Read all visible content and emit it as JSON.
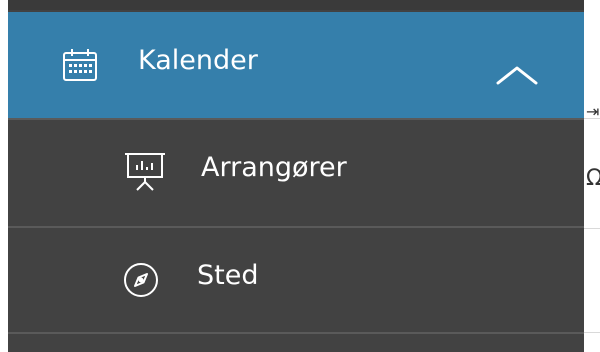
{
  "menu": {
    "items": [
      {
        "label": "Kalender",
        "icon": "calendar-icon",
        "expanded": true
      },
      {
        "label": "Arrangører",
        "icon": "presentation-chart-icon"
      },
      {
        "label": "Sted",
        "icon": "compass-icon"
      }
    ],
    "colors": {
      "active_background": "#357fab",
      "menu_background": "#424242",
      "divider": "#5a5a5a",
      "text": "#ffffff"
    }
  }
}
